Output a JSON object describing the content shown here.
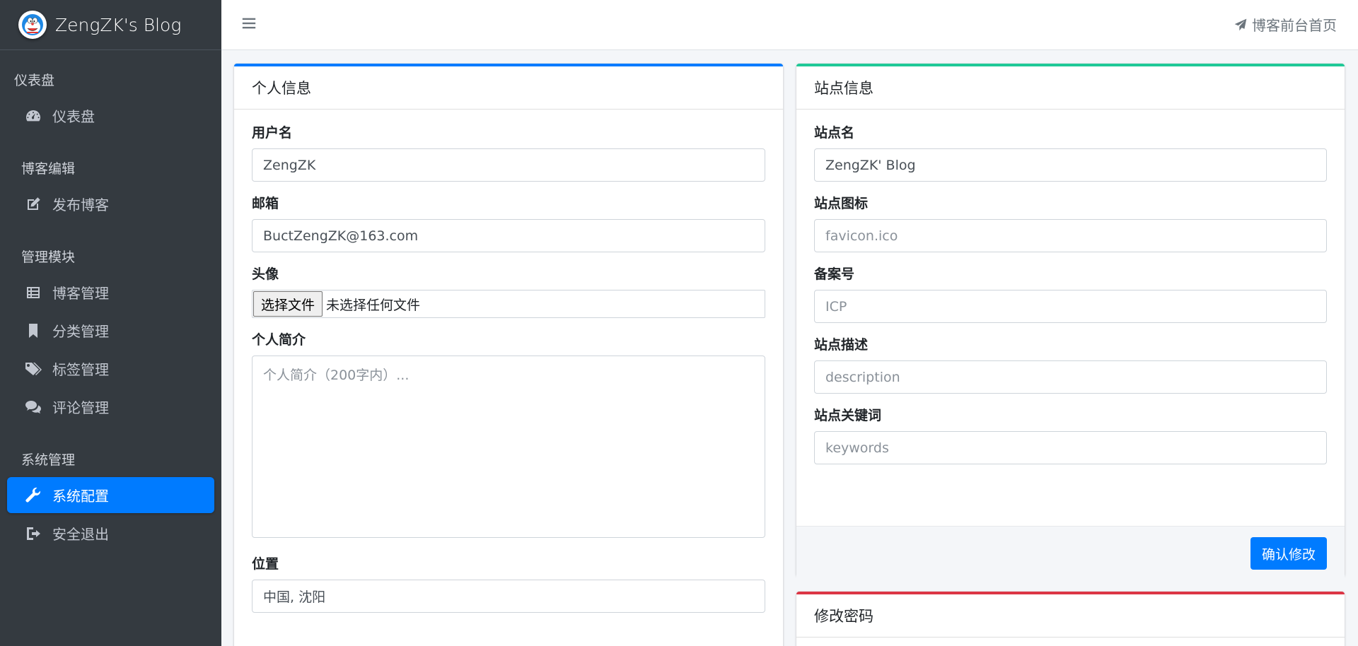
{
  "brand": {
    "name": "ZengZK's Blog",
    "logo_icon": "doraemon-avatar-icon"
  },
  "sidebar": {
    "sections": [
      {
        "header": "仪表盘",
        "items": [
          {
            "label": "仪表盘",
            "icon": "tachometer-icon"
          }
        ]
      },
      {
        "header": "博客编辑",
        "items": [
          {
            "label": "发布博客",
            "icon": "edit-icon"
          }
        ]
      },
      {
        "header": "管理模块",
        "items": [
          {
            "label": "博客管理",
            "icon": "list-icon"
          },
          {
            "label": "分类管理",
            "icon": "bookmark-icon"
          },
          {
            "label": "标签管理",
            "icon": "tags-icon"
          },
          {
            "label": "评论管理",
            "icon": "comments-icon"
          }
        ]
      },
      {
        "header": "系统管理",
        "items": [
          {
            "label": "系统配置",
            "icon": "wrench-icon",
            "active": true
          },
          {
            "label": "安全退出",
            "icon": "sign-out-icon"
          }
        ]
      }
    ]
  },
  "topbar": {
    "front_link": "博客前台首页",
    "front_icon": "paper-plane-icon"
  },
  "personal": {
    "title": "个人信息",
    "accent": "#007bff",
    "username_label": "用户名",
    "username_value": "ZengZK",
    "email_label": "邮箱",
    "email_value": "BuctZengZK@163.com",
    "avatar_label": "头像",
    "file_button": "选择文件",
    "file_status": "未选择任何文件",
    "bio_label": "个人简介",
    "bio_placeholder": "个人简介（200字内）...",
    "location_label": "位置",
    "location_value": "中国, 沈阳"
  },
  "site": {
    "title": "站点信息",
    "accent": "#20c997",
    "name_label": "站点名",
    "name_value": "ZengZK' Blog",
    "icon_label": "站点图标",
    "icon_placeholder": "favicon.ico",
    "icp_label": "备案号",
    "icp_placeholder": "ICP",
    "desc_label": "站点描述",
    "desc_placeholder": "description",
    "keywords_label": "站点关键词",
    "keywords_placeholder": "keywords",
    "submit": "确认修改"
  },
  "password": {
    "title": "修改密码",
    "accent": "#dc3545"
  }
}
